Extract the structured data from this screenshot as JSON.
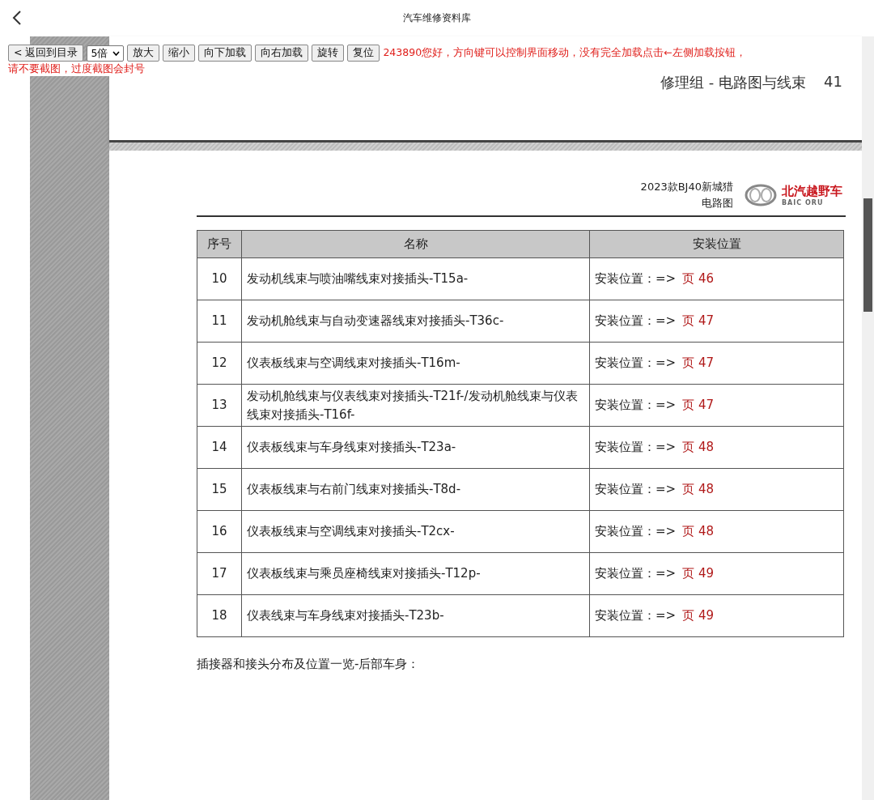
{
  "header": {
    "title": "汽车维修资料库"
  },
  "toolbar": {
    "back_button": "< 返回到目录",
    "zoom_select": "5倍",
    "buttons": [
      "放大",
      "缩小",
      "向下加载",
      "向右加载",
      "旋转",
      "复位"
    ],
    "notice": [
      "243890您好，方向键可以控制界面移动，没有完全加载点击←左侧加载按钮，",
      "请不要截图，过度截图会封号"
    ]
  },
  "previous_page": {
    "running_header": "修理组 - 电路图与线束",
    "page_number": "41"
  },
  "document": {
    "model": "2023款BJ40新城猎",
    "subtitle": "电路图",
    "logo": {
      "name": "北汽越野车",
      "latin": "BAIC ORU"
    }
  },
  "table": {
    "columns": [
      "序号",
      "名称",
      "安装位置"
    ],
    "rows": [
      {
        "no": "10",
        "name": "发动机线束与喷油嘴线束对接插头-T15a-",
        "location_label": "安装位置：=>",
        "page": "页 46"
      },
      {
        "no": "11",
        "name": "发动机舱线束与自动变速器线束对接插头-T36c-",
        "location_label": "安装位置：=>",
        "page": "页 47"
      },
      {
        "no": "12",
        "name": "仪表板线束与空调线束对接插头-T16m-",
        "location_label": "安装位置：=>",
        "page": "页 47"
      },
      {
        "no": "13",
        "name": "发动机舱线束与仪表线束对接插头-T21f-/发动机舱线束与仪表线束对接插头-T16f-",
        "location_label": "安装位置：=>",
        "page": "页 47"
      },
      {
        "no": "14",
        "name": "仪表板线束与车身线束对接插头-T23a-",
        "location_label": "安装位置：=>",
        "page": "页 48"
      },
      {
        "no": "15",
        "name": "仪表板线束与右前门线束对接插头-T8d-",
        "location_label": "安装位置：=>",
        "page": "页 48"
      },
      {
        "no": "16",
        "name": "仪表板线束与空调线束对接插头-T2cx-",
        "location_label": "安装位置：=>",
        "page": "页 48"
      },
      {
        "no": "17",
        "name": "仪表板线束与乘员座椅线束对接插头-T12p-",
        "location_label": "安装位置：=>",
        "page": "页 49"
      },
      {
        "no": "18",
        "name": "仪表线束与车身线束对接插头-T23b-",
        "location_label": "安装位置：=>",
        "page": "页 49"
      }
    ]
  },
  "section_heading": "插接器和接头分布及位置一览-后部车身："
}
